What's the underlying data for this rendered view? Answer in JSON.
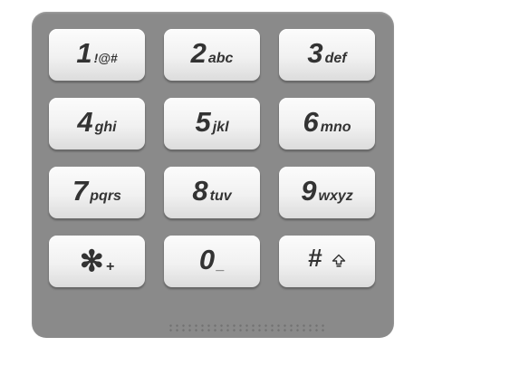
{
  "keypad": {
    "keys": [
      {
        "digit": "1",
        "letters": "!@#"
      },
      {
        "digit": "2",
        "letters": "abc"
      },
      {
        "digit": "3",
        "letters": "def"
      },
      {
        "digit": "4",
        "letters": "ghi"
      },
      {
        "digit": "5",
        "letters": "jkl"
      },
      {
        "digit": "6",
        "letters": "mno"
      },
      {
        "digit": "7",
        "letters": "pqrs"
      },
      {
        "digit": "8",
        "letters": "tuv"
      },
      {
        "digit": "9",
        "letters": "wxyz"
      },
      {
        "digit": "✻",
        "letters": "+"
      },
      {
        "digit": "0",
        "letters": "_"
      },
      {
        "digit": "#",
        "icon": "shift-arrow-icon"
      }
    ]
  }
}
